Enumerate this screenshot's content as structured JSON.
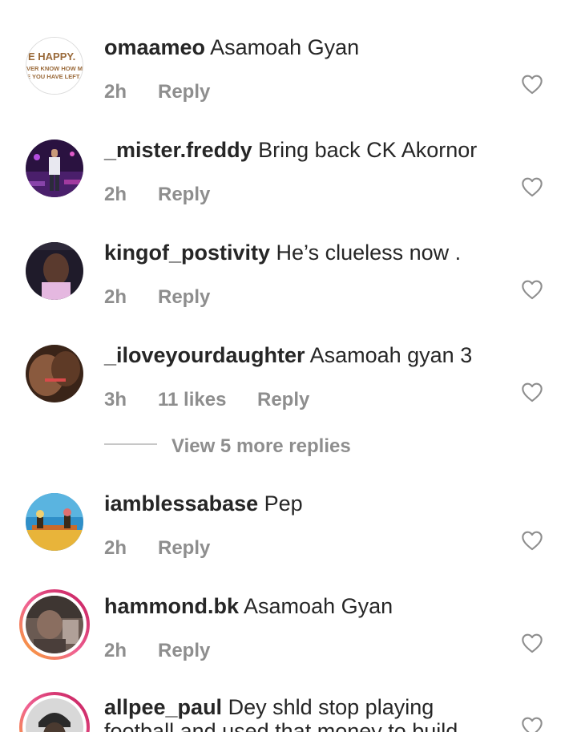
{
  "comments": [
    {
      "username": "omaameo",
      "text": "Asamoah Gyan",
      "time": "2h",
      "likes": "",
      "reply": "Reply",
      "avatar_text": [
        "E HAPPY.",
        "VER KNOW HOW MUC",
        "E YOU HAVE LEFT."
      ]
    },
    {
      "username": "_mister.freddy",
      "text": "Bring back CK Akornor",
      "time": "2h",
      "likes": "",
      "reply": "Reply"
    },
    {
      "username": "kingof_postivity",
      "text": "He’s clueless now .",
      "time": "2h",
      "likes": "",
      "reply": "Reply"
    },
    {
      "username": "_iloveyourdaughter",
      "text": "Asamoah gyan 3",
      "time": "3h",
      "likes": "11 likes",
      "reply": "Reply"
    },
    {
      "username": "iamblessabase",
      "text": "Pep",
      "time": "2h",
      "likes": "",
      "reply": "Reply"
    },
    {
      "username": "hammond.bk",
      "text": "Asamoah Gyan",
      "time": "2h",
      "likes": "",
      "reply": "Reply"
    },
    {
      "username": "allpee_paul",
      "text": "Dey shld stop playing football and used that money to build",
      "time": "",
      "likes": "",
      "reply": ""
    }
  ],
  "view_more_replies": "View 5 more replies",
  "icons": {
    "like": "heart-outline-icon"
  },
  "colors": {
    "text": "#262626",
    "muted": "#8e8e8e",
    "divider": "#c7c7c7"
  }
}
